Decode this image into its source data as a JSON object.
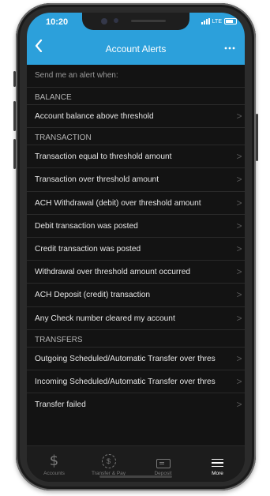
{
  "status_bar": {
    "time": "10:20",
    "network": "LTE"
  },
  "header": {
    "title": "Account Alerts",
    "back_icon": "chevron-left-icon",
    "more_icon": "ellipsis-icon",
    "color": "#2ca0db"
  },
  "intro": "Send me an alert when:",
  "sections": [
    {
      "title": "BALANCE",
      "items": [
        "Account balance above threshold"
      ]
    },
    {
      "title": "TRANSACTION",
      "items": [
        "Transaction equal to threshold amount",
        "Transaction over threshold amount",
        "ACH Withdrawal (debit) over threshold amount",
        "Debit transaction was posted",
        "Credit transaction was posted",
        "Withdrawal over threshold amount occurred",
        "ACH Deposit (credit) transaction",
        "Any Check number cleared my account"
      ]
    },
    {
      "title": "TRANSFERS",
      "items": [
        "Outgoing Scheduled/Automatic Transfer over thres",
        "Incoming Scheduled/Automatic Transfer over thres",
        "Transfer failed"
      ]
    }
  ],
  "chevron": ">",
  "tabbar": [
    {
      "label": "Accounts",
      "icon": "dollar-icon",
      "active": false
    },
    {
      "label": "Transfer & Pay",
      "icon": "coin-icon",
      "active": false
    },
    {
      "label": "Deposit",
      "icon": "check-deposit-icon",
      "active": false
    },
    {
      "label": "More",
      "icon": "menu-icon",
      "active": true
    }
  ]
}
